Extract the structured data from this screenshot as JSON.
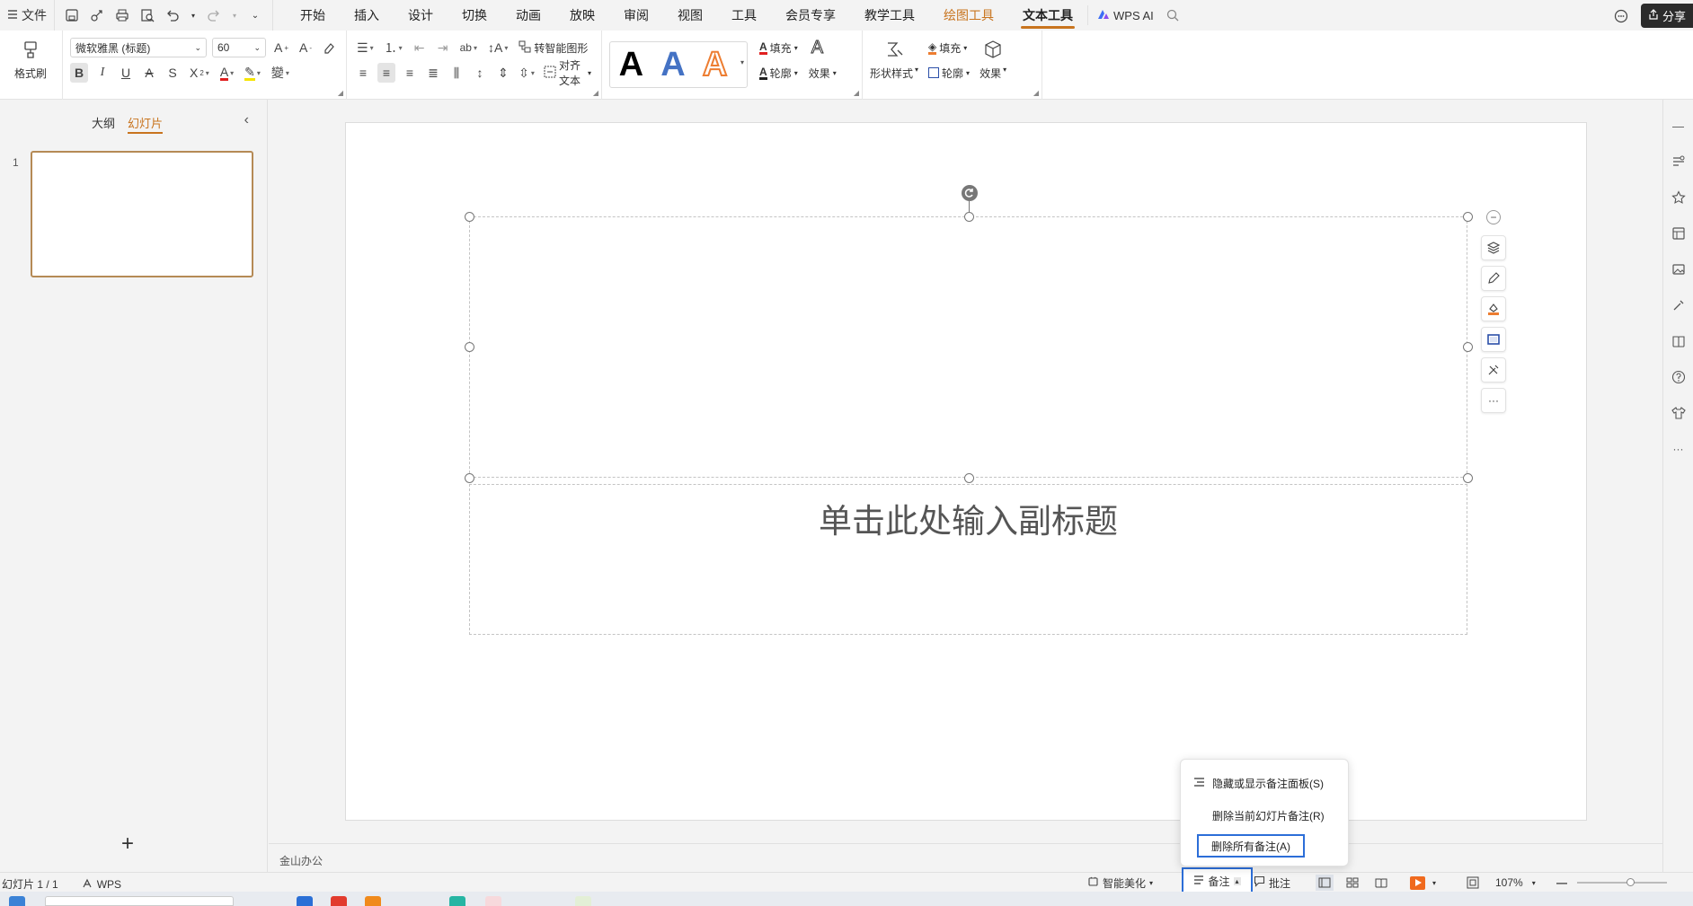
{
  "topbar": {
    "file_label": "文件",
    "tabs": [
      "开始",
      "插入",
      "设计",
      "切换",
      "动画",
      "放映",
      "审阅",
      "视图",
      "工具",
      "会员专享",
      "教学工具",
      "绘图工具",
      "文本工具"
    ],
    "active_tab": "文本工具",
    "wps_ai_label": "WPS AI",
    "share_label": "分享"
  },
  "ribbon": {
    "format_painter": "格式刷",
    "font_name": "微软雅黑 (标题)",
    "font_size": "60",
    "to_smart_shape": "转智能图形",
    "align_text": "对齐文本",
    "text_fill": "填充",
    "text_outline": "轮廓",
    "text_effect": "效果",
    "shape_style": "形状样式",
    "shape_fill": "填充",
    "shape_outline": "轮廓",
    "shape_effect": "效果",
    "wordart_letter": "A"
  },
  "left_panel": {
    "tab_outline": "大纲",
    "tab_slides": "幻灯片",
    "slide_number": "1",
    "add_icon": "+"
  },
  "slide": {
    "subtitle_placeholder": "单击此处输入副标题"
  },
  "notes": {
    "text": "金山办公"
  },
  "statusbar": {
    "slide_info": "幻灯片 1 / 1",
    "theme": "WPS",
    "smart_beautify": "智能美化",
    "notes_label": "备注",
    "comments_label": "批注",
    "zoom": "107%",
    "minus": "—"
  },
  "popup": {
    "items": [
      "隐藏或显示备注面板(S)",
      "删除当前幻灯片备注(R)",
      "删除所有备注(A)"
    ]
  },
  "colors": {
    "accent": "#c8741e",
    "selection_blue": "#2c6ed8",
    "wordart_blue": "#4472c4",
    "wordart_orange": "#ed7d31",
    "font_color_red": "#e02020",
    "highlight_yellow": "#f5e400",
    "play_orange": "#f06a1e"
  }
}
